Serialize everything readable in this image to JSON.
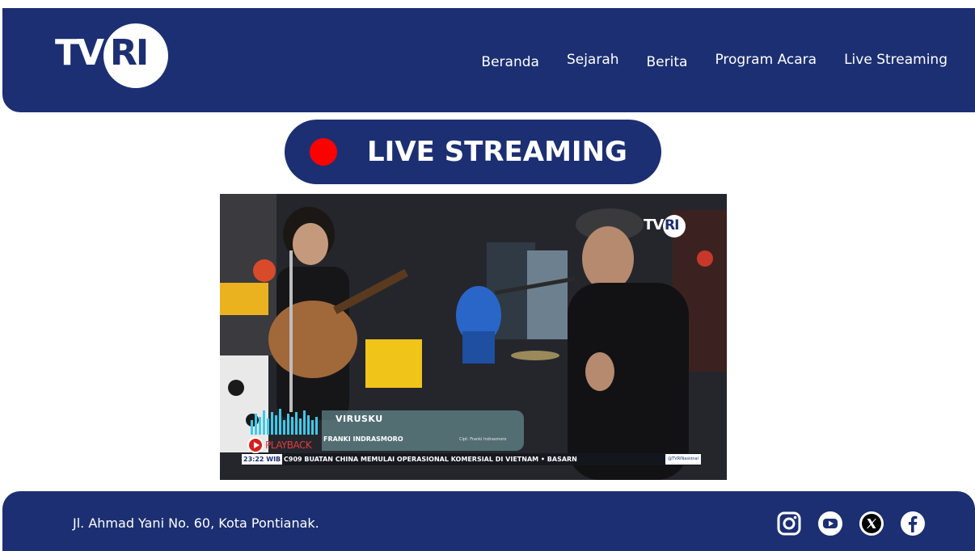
{
  "header": {
    "logo": {
      "left_text": "TV",
      "right_text": "RI"
    },
    "nav": [
      {
        "label": "Beranda"
      },
      {
        "label": "Sejarah"
      },
      {
        "label": "Berita"
      },
      {
        "label": "Program Acara"
      },
      {
        "label": "Live Streaming"
      }
    ]
  },
  "live_badge": {
    "label": "LIVE STREAMING",
    "dot_color": "#ff0000"
  },
  "video": {
    "channel_logo": {
      "left_text": "TV",
      "right_text": "RI"
    },
    "song_title": "VIRUSKU",
    "artist": "FRANKI INDRASMORO",
    "credit": "Cipt: Franki Indrasmoro",
    "playback_label": "PLAYBACK",
    "ticker": {
      "time": "23:22 WIB",
      "headline": "C909 BUATAN CHINA MEMULAI OPERASIONAL KOMERSIAL DI VIETNAM  •  BASARN",
      "handle": "@TVRINasional"
    }
  },
  "footer": {
    "address": "Jl. Ahmad Yani No. 60, Kota Pontianak.",
    "socials": [
      {
        "icon": "instagram-icon"
      },
      {
        "icon": "youtube-icon"
      },
      {
        "icon": "x-icon"
      },
      {
        "icon": "facebook-icon"
      }
    ]
  },
  "colors": {
    "brand_navy": "#1c2f72",
    "live_red": "#ff0000",
    "background": "#ffffff"
  }
}
